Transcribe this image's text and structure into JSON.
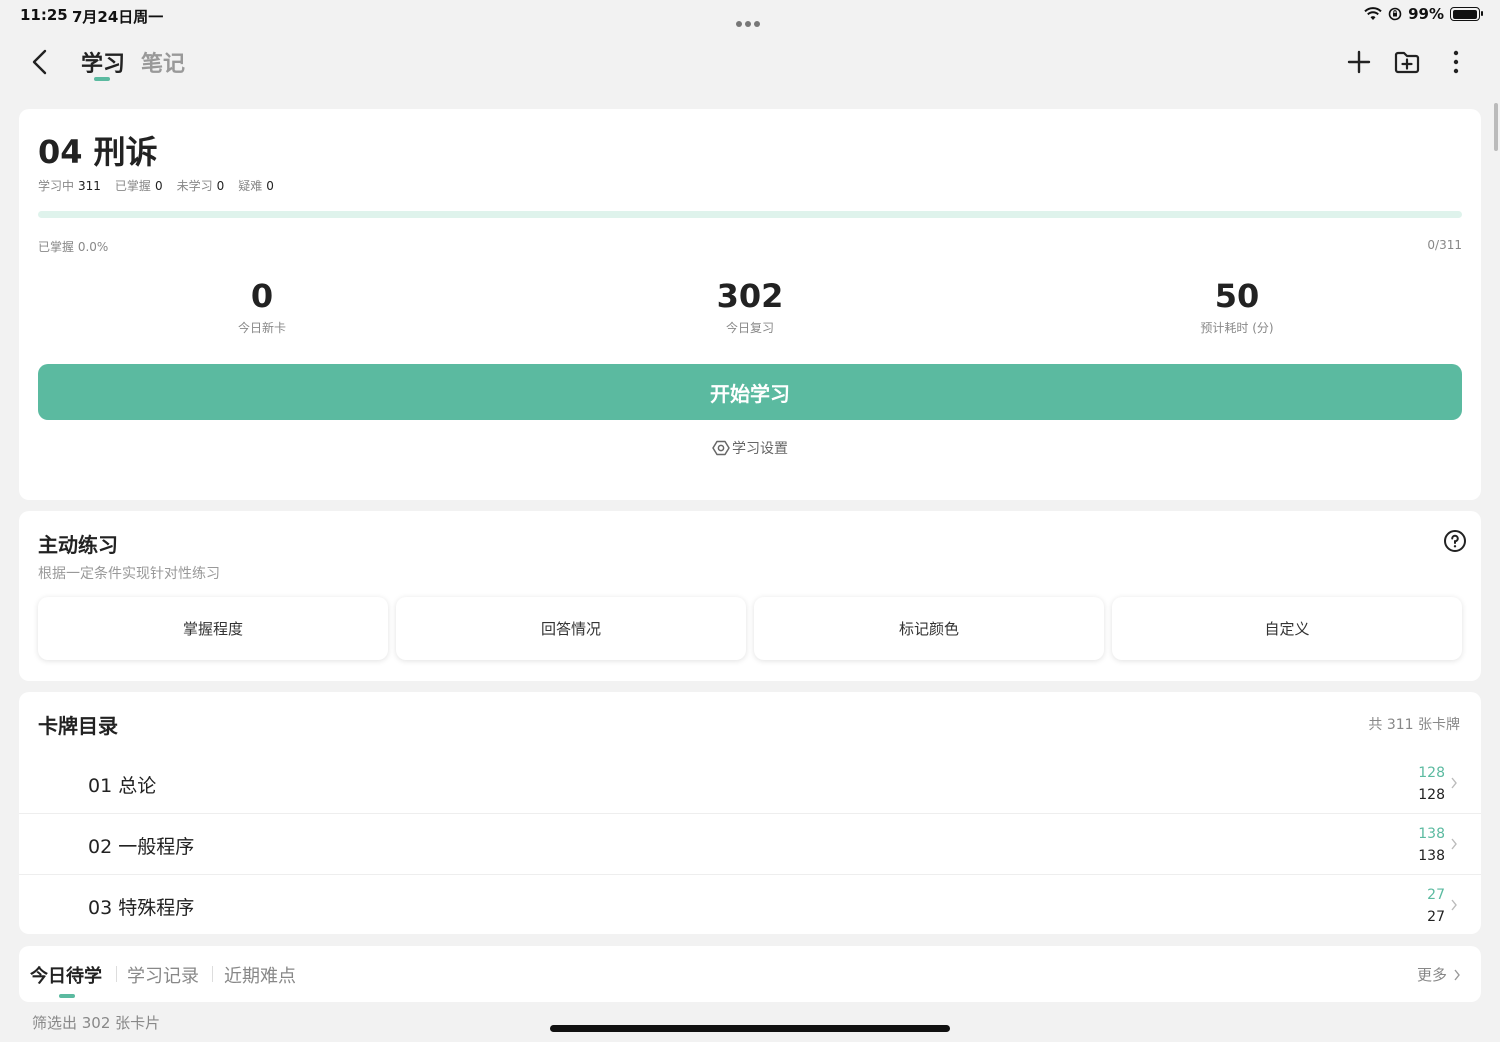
{
  "status_bar": {
    "time": "11:25",
    "date": "7月24日周一",
    "battery": "99%"
  },
  "nav": {
    "tabs": [
      {
        "label": "学习"
      },
      {
        "label": "笔记"
      }
    ]
  },
  "deck": {
    "title": "04 刑诉",
    "stats": [
      {
        "label": "学习中",
        "value": "311"
      },
      {
        "label": "已掌握",
        "value": "0"
      },
      {
        "label": "未学习",
        "value": "0"
      },
      {
        "label": "疑难",
        "value": "0"
      }
    ],
    "mastered_fraction": 0.0,
    "mastered_label": "已掌握 0.0%",
    "count_label": "0/311",
    "metrics": [
      {
        "value": "0",
        "label": "今日新卡"
      },
      {
        "value": "302",
        "label": "今日复习"
      },
      {
        "value": "50",
        "label": "预计耗时 (分)"
      }
    ],
    "start_button": "开始学习",
    "settings_link": "学习设置"
  },
  "practice": {
    "title": "主动练习",
    "subtitle": "根据一定条件实现针对性练习",
    "buttons": [
      "掌握程度",
      "回答情况",
      "标记颜色",
      "自定义"
    ]
  },
  "catalog": {
    "title": "卡牌目录",
    "total": "共 311 张卡牌",
    "items": [
      {
        "name": "01 总论",
        "due": "128",
        "total": "128"
      },
      {
        "name": "02 一般程序",
        "due": "138",
        "total": "138"
      },
      {
        "name": "03 特殊程序",
        "due": "27",
        "total": "27"
      }
    ]
  },
  "bottom_tabs": {
    "tabs": [
      "今日待学",
      "学习记录",
      "近期难点"
    ],
    "more": "更多"
  },
  "filter_text": "筛选出 302 张卡片",
  "colors": {
    "accent": "#5bbaa0",
    "accent_light": "#dff3ec",
    "background": "#f2f2f2"
  }
}
